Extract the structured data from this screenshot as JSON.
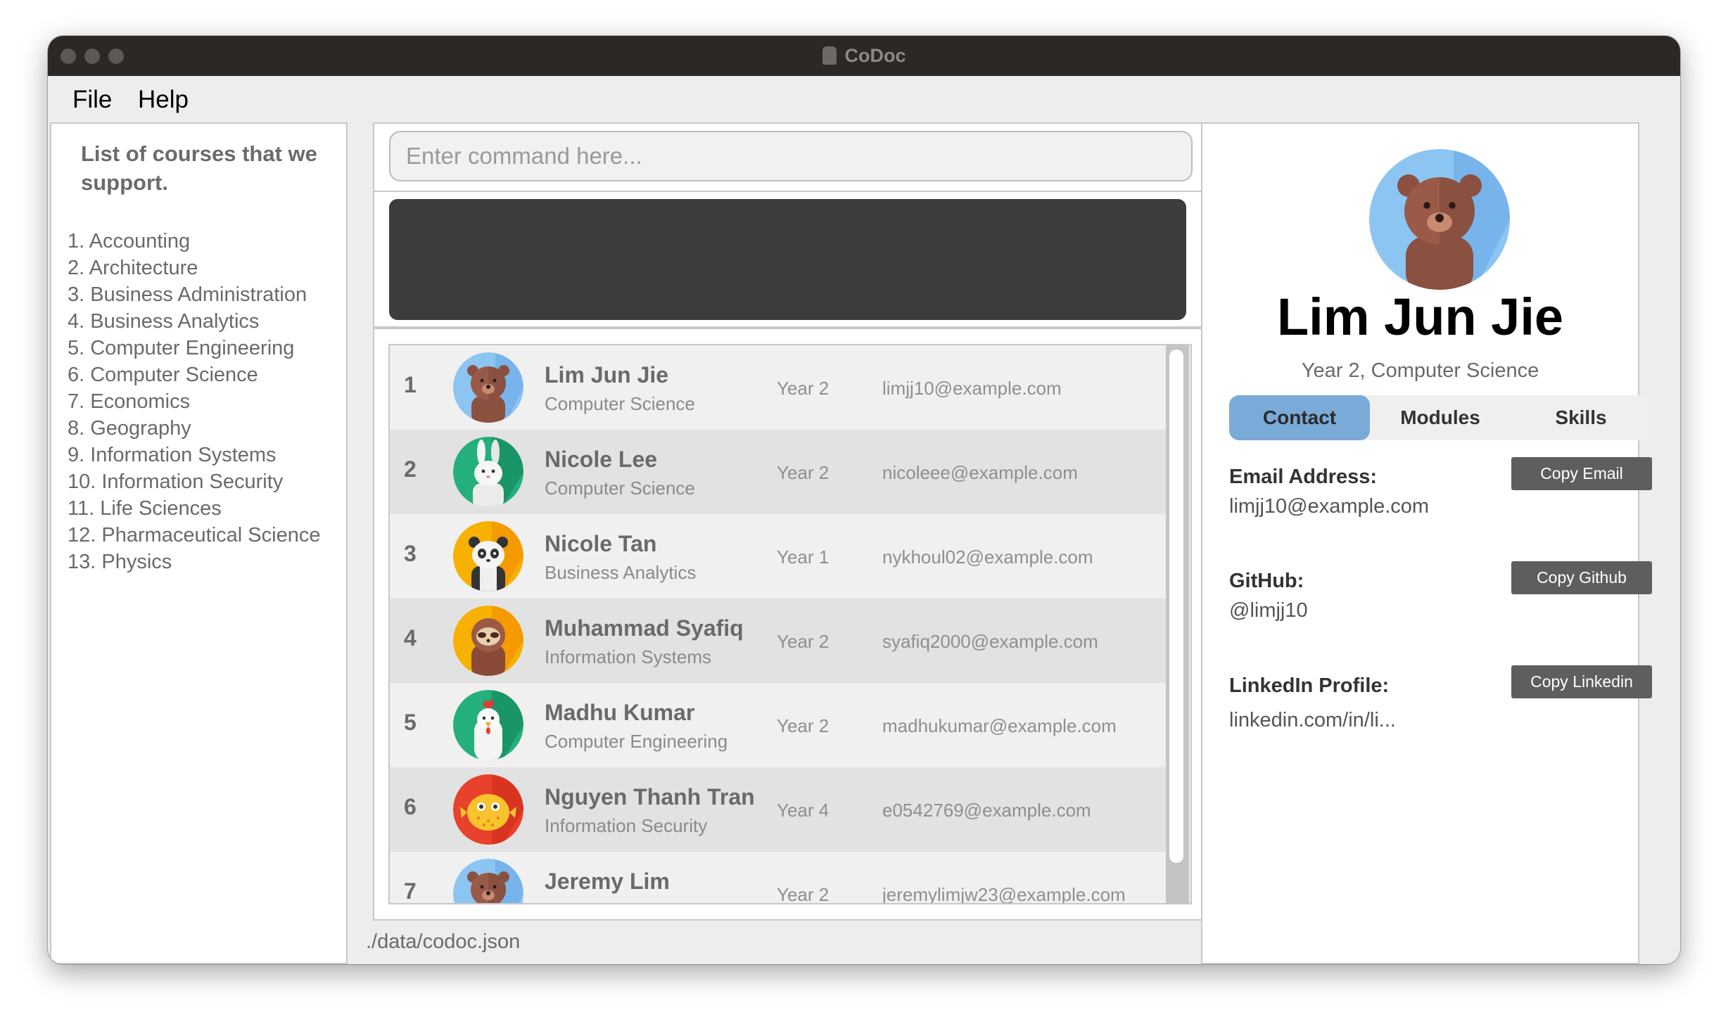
{
  "window": {
    "title": "CoDoc"
  },
  "menu": {
    "file": "File",
    "help": "Help"
  },
  "courses": {
    "heading": "List of courses that we support.",
    "items": [
      "1. Accounting",
      "2. Architecture",
      "3. Business Administration",
      "4. Business Analytics",
      "5. Computer Engineering",
      "6. Computer Science",
      "7. Economics",
      "8. Geography",
      "9. Information Systems",
      "10. Information Security",
      "11. Life Sciences",
      "12. Pharmaceutical Science",
      "13. Physics"
    ]
  },
  "command": {
    "placeholder": "Enter command here...",
    "value": ""
  },
  "result": {
    "text": ""
  },
  "people": [
    {
      "index": "1",
      "name": "Lim Jun Jie",
      "course": "Computer Science",
      "year": "Year 2",
      "email": "limjj10@example.com",
      "avatar": "bear-icon"
    },
    {
      "index": "2",
      "name": "Nicole Lee",
      "course": "Computer Science",
      "year": "Year 2",
      "email": "nicoleee@example.com",
      "avatar": "rabbit-icon"
    },
    {
      "index": "3",
      "name": "Nicole Tan",
      "course": "Business Analytics",
      "year": "Year 1",
      "email": "nykhoul02@example.com",
      "avatar": "panda-icon"
    },
    {
      "index": "4",
      "name": "Muhammad Syafiq",
      "course": "Information Systems",
      "year": "Year 2",
      "email": "syafiq2000@example.com",
      "avatar": "sloth-icon"
    },
    {
      "index": "5",
      "name": "Madhu Kumar",
      "course": "Computer Engineering",
      "year": "Year 2",
      "email": "madhukumar@example.com",
      "avatar": "chicken-icon"
    },
    {
      "index": "6",
      "name": "Nguyen Thanh Tran",
      "course": "Information Security",
      "year": "Year 4",
      "email": "e0542769@example.com",
      "avatar": "pufferfish-icon"
    },
    {
      "index": "7",
      "name": "Jeremy Lim",
      "course": "",
      "year": "Year 2",
      "email": "jeremylimjw23@example.com",
      "avatar": "bear-icon"
    }
  ],
  "status": {
    "path": "./data/codoc.json"
  },
  "detail": {
    "name": "Lim Jun Jie",
    "subtitle": "Year 2, Computer Science",
    "avatar": "bear-icon",
    "tabs": [
      "Contact",
      "Modules",
      "Skills"
    ],
    "active_tab": "Contact",
    "email_label": "Email Address:",
    "email_value": "limjj10@example.com",
    "github_label": "GitHub:",
    "github_value": "@limjj10",
    "linkedin_label": "LinkedIn Profile:",
    "linkedin_value": "linkedin.com/in/li...",
    "copy_email": "Copy Email",
    "copy_github": "Copy Github",
    "copy_linkedin": "Copy Linkedin"
  },
  "colors": {
    "titlebar": "#2b2826",
    "accent_tab": "#7aaad8",
    "result_bg": "#3c3c3c",
    "copy_button": "#5e5e5e"
  }
}
